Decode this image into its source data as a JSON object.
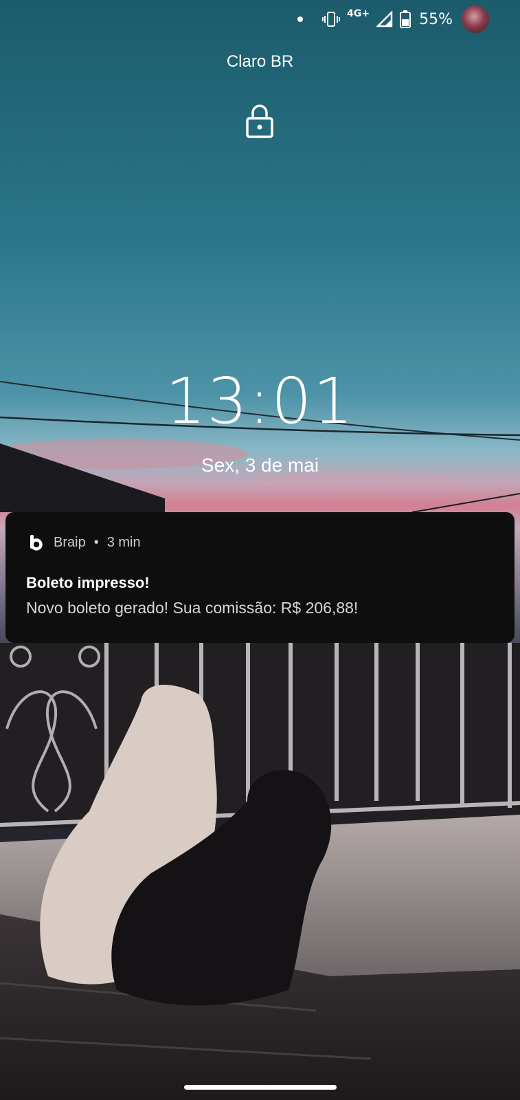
{
  "status_bar": {
    "network": "4G+",
    "battery": "55%"
  },
  "lockscreen": {
    "carrier": "Claro BR",
    "time": "13:01",
    "date": "Sex, 3 de mai"
  },
  "notification": {
    "app_name": "Braip",
    "separator": "•",
    "time": "3 min",
    "title": "Boleto impresso!",
    "body": "Novo boleto gerado! Sua comissão: R$ 206,88!"
  }
}
